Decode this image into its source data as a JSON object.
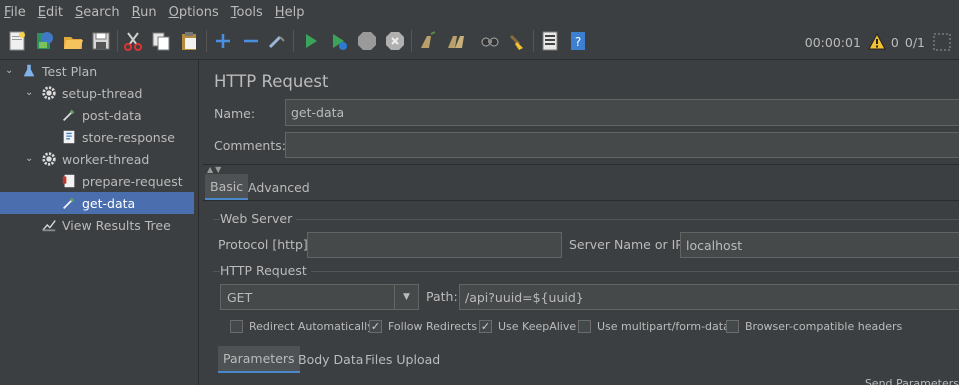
{
  "menu": {
    "items": [
      {
        "first": "F",
        "rest": "ile"
      },
      {
        "first": "E",
        "rest": "dit"
      },
      {
        "first": "S",
        "rest": "earch"
      },
      {
        "first": "R",
        "rest": "un"
      },
      {
        "first": "O",
        "rest": "ptions"
      },
      {
        "first": "T",
        "rest": "ools"
      },
      {
        "first": "H",
        "rest": "elp"
      }
    ]
  },
  "toolbar": {
    "elapsed_time": "00:00:01",
    "warning_count": "0",
    "thread_ratio": "0/1",
    "icons": [
      "new-icon",
      "templates-icon",
      "open-icon",
      "save-icon",
      "cut-icon",
      "copy-icon",
      "paste-icon",
      "expand-icon",
      "collapse-icon",
      "toggle-icon",
      "start-icon",
      "start-no-pauses-icon",
      "stop-icon",
      "shutdown-icon",
      "clear-icon",
      "clear-all-icon",
      "search-icon",
      "reset-search-icon",
      "function-helper-icon",
      "help-icon"
    ]
  },
  "tree": {
    "test_plan": "Test Plan",
    "setup_thread": "setup-thread",
    "post_data": "post-data",
    "store_response": "store-response",
    "worker_thread": "worker-thread",
    "prepare_request": "prepare-request",
    "get_data": "get-data",
    "view_results_tree": "View Results Tree"
  },
  "form": {
    "title": "HTTP Request",
    "name_label": "Name:",
    "name_value": "get-data",
    "comments_label": "Comments:",
    "comments_value": "",
    "tabs": {
      "basic": "Basic",
      "advanced": "Advanced"
    },
    "web_server_label": "Web Server",
    "protocol_label": "Protocol [http]:",
    "protocol_value": "",
    "server_label": "Server Name or IP:",
    "server_value": "localhost",
    "http_request_label": "HTTP Request",
    "method_value": "GET",
    "path_label": "Path:",
    "path_value": "/api?uuid=${uuid}",
    "checkboxes": {
      "redirect_auto": {
        "label": "Redirect Automatically",
        "checked": false
      },
      "follow_redirects": {
        "label": "Follow Redirects",
        "checked": true
      },
      "keepalive": {
        "label": "Use KeepAlive",
        "checked": true
      },
      "multipart": {
        "label": "Use multipart/form-data",
        "checked": false
      },
      "browser_headers": {
        "label": "Browser-compatible headers",
        "checked": false
      }
    },
    "sub_tabs": {
      "parameters": "Parameters",
      "body_data": "Body Data",
      "files_upload": "Files Upload"
    },
    "send_params_label": "Send Parameters"
  },
  "colors": {
    "background": "#3c3f41",
    "selection": "#4b6eaf",
    "field": "#45494a",
    "tab_accent": "#4a88c7"
  }
}
